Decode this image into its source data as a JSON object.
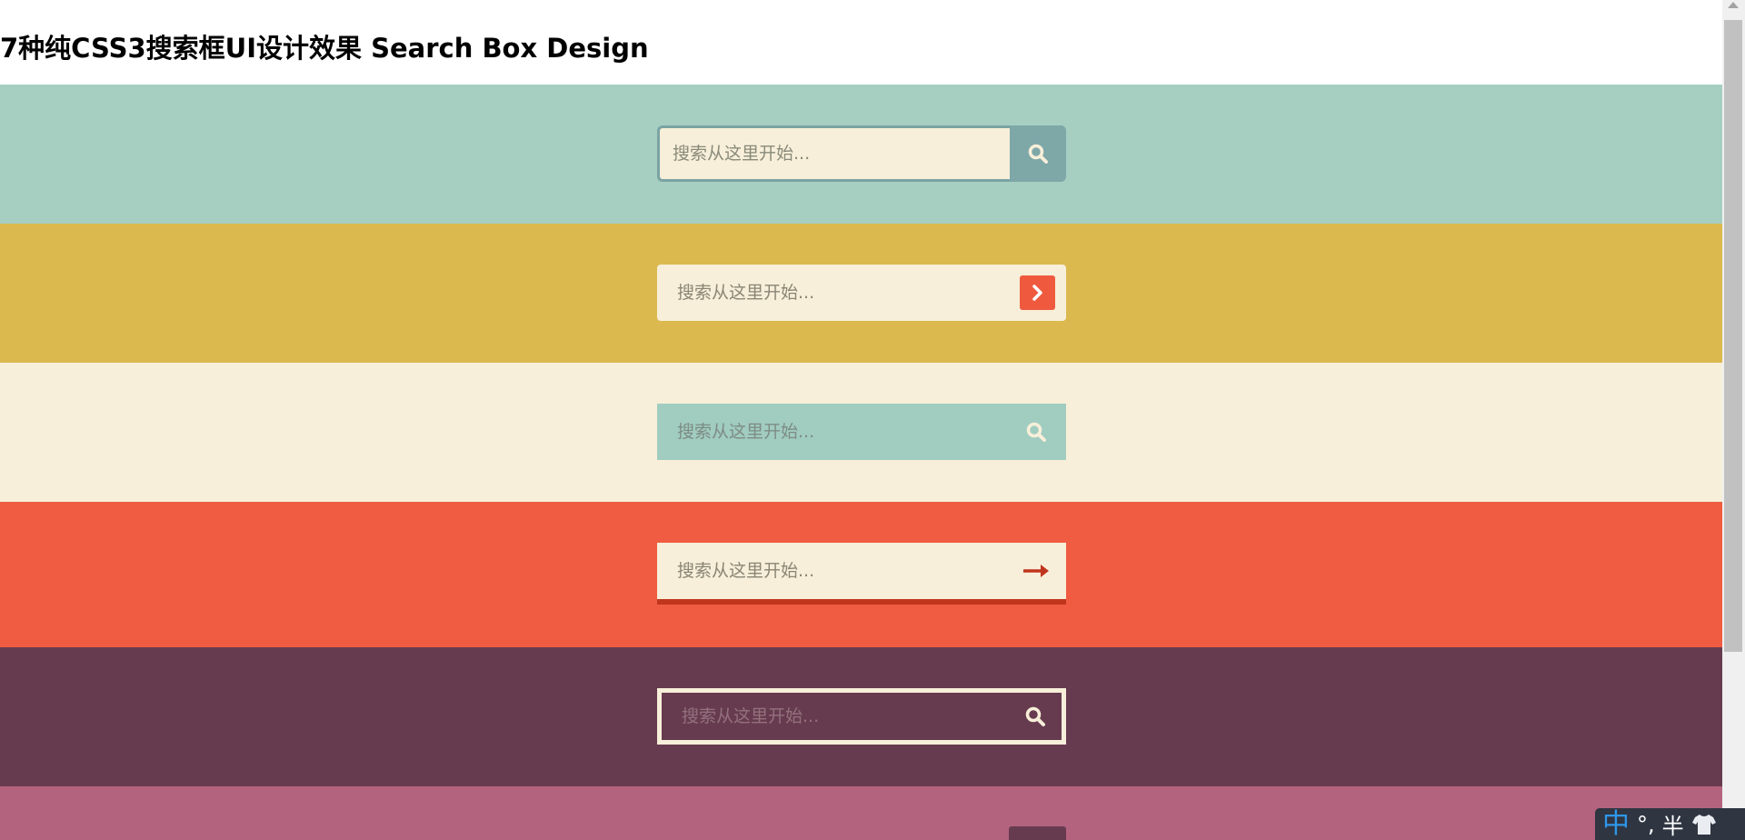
{
  "page": {
    "title": "7种纯CSS3搜索框UI设计效果 Search Box Design"
  },
  "colors": {
    "band1": "#a6cfc2",
    "band2": "#dbb94f",
    "band3": "#f7efd9",
    "band4": "#f05c41",
    "band5": "#673b4f",
    "band6": "#b4637f",
    "icon_light": "#f7efd9",
    "accent_red": "#c0351d"
  },
  "search_boxes": [
    {
      "placeholder": "搜索从这里开始...",
      "icon": "search-icon"
    },
    {
      "placeholder": "搜索从这里开始...",
      "icon": "chevron-right-icon"
    },
    {
      "placeholder": "搜索从这里开始...",
      "icon": "search-icon"
    },
    {
      "placeholder": "搜索从这里开始...",
      "icon": "arrow-right-icon"
    },
    {
      "placeholder": "搜索从这里开始...",
      "icon": "search-icon"
    }
  ],
  "ime": {
    "lang": "中",
    "punct": "°,",
    "width": "半",
    "skin_icon": "shirt-icon"
  }
}
